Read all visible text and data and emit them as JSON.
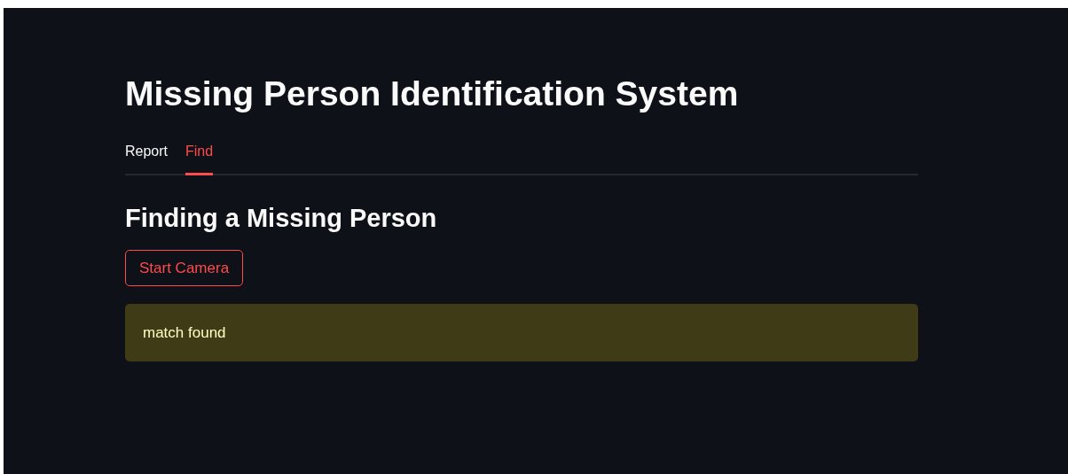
{
  "title": "Missing Person Identification System",
  "tabs": [
    {
      "label": "Report",
      "selected": false
    },
    {
      "label": "Find",
      "selected": true
    }
  ],
  "section": {
    "heading": "Finding a Missing Person",
    "button": "Start Camera",
    "alert": {
      "kind": "warning",
      "text": "match found"
    }
  }
}
